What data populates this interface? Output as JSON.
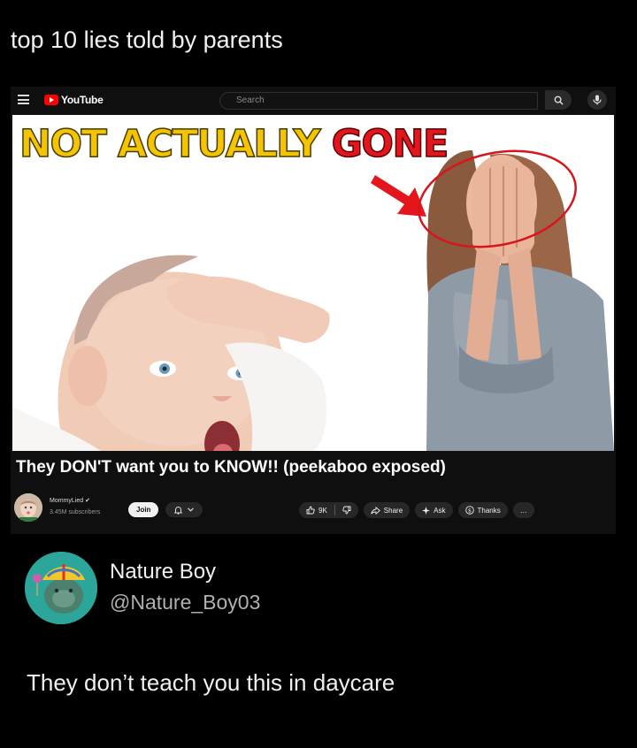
{
  "post": {
    "caption": "top 10 lies told by parents"
  },
  "youtube": {
    "logo_text": "YouTube",
    "search_placeholder": "Search",
    "thumbnail": {
      "headline_yellow": "NOT ACTUALLY",
      "headline_red": "GONE",
      "headline_red_color": "#e3161e",
      "headline_yellow_color": "#f2c500"
    },
    "video_title": "They DON'T want you to KNOW!! (peekaboo exposed)",
    "channel": {
      "name": "MommyLied ✔",
      "subscribers": "3.45M subscribers"
    },
    "join_label": "Join",
    "actions": {
      "likes": "9K",
      "share": "Share",
      "ask": "Ask",
      "thanks": "Thanks",
      "more": "…"
    }
  },
  "tweet": {
    "display_name": "Nature Boy",
    "handle": "@Nature_Boy03",
    "text": "They don’t teach you this in daycare"
  }
}
